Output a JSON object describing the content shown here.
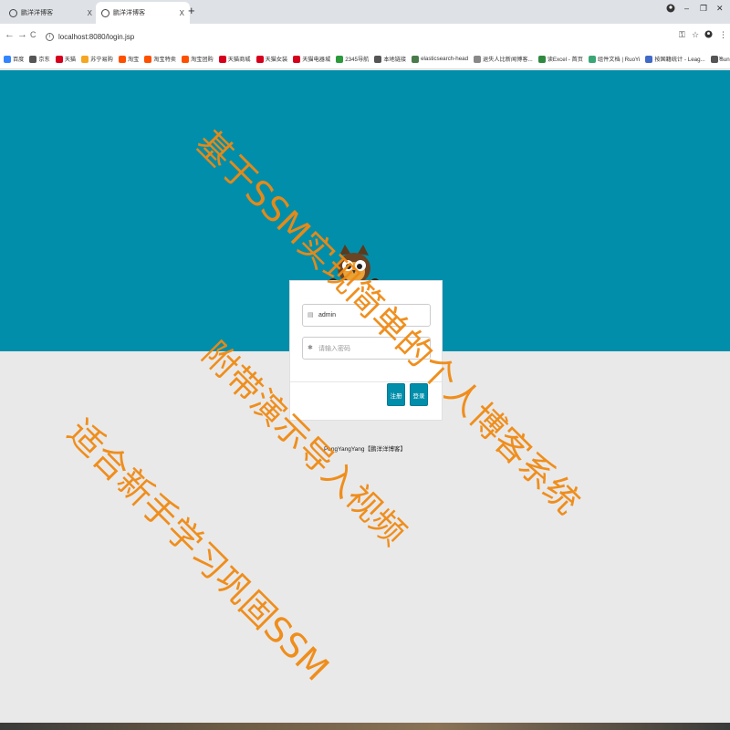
{
  "browser": {
    "tabs": [
      {
        "label": "鹏洋洋博客",
        "close": "X"
      },
      {
        "label": "鹏洋洋博客",
        "close": "X"
      }
    ],
    "new_tab": "+",
    "window_controls": {
      "minimize": "–",
      "restore": "❐",
      "close": "✕"
    },
    "nav": {
      "back": "←",
      "forward": "→",
      "reload": "C"
    },
    "url": "localhost:8080/login.jsp",
    "bookmarks": [
      {
        "label": "百度",
        "color": "#3385ff"
      },
      {
        "label": "京东",
        "color": "#555555"
      },
      {
        "label": "天猫",
        "color": "#d6001c"
      },
      {
        "label": "苏宁易购",
        "color": "#f5a623"
      },
      {
        "label": "淘宝",
        "color": "#ff5000"
      },
      {
        "label": "淘宝特卖",
        "color": "#ff5000"
      },
      {
        "label": "淘宝团购",
        "color": "#ff5000"
      },
      {
        "label": "天猫商城",
        "color": "#d6001c"
      },
      {
        "label": "天猫女装",
        "color": "#d6001c"
      },
      {
        "label": "天猫电器城",
        "color": "#d6001c"
      },
      {
        "label": "2345导航",
        "color": "#2b9a3c"
      },
      {
        "label": "本地链接",
        "color": "#555555"
      },
      {
        "label": "elasticsearch-head",
        "color": "#4a7a4a"
      },
      {
        "label": "退失人比新闻博客...",
        "color": "#888888"
      },
      {
        "label": "读Excel - 首页",
        "color": "#2f8a3f"
      },
      {
        "label": "组件文档 | RuoYi",
        "color": "#3aa675"
      },
      {
        "label": "按国籍统计 - Leag...",
        "color": "#4169c8"
      },
      {
        "label": "Sunny-Ngrok内网...",
        "color": "#555555"
      }
    ],
    "bookmarks_more": "»"
  },
  "login": {
    "username_value": "admin",
    "password_placeholder": "请输入密码",
    "register_label": "注册",
    "login_label": "登录"
  },
  "footer": {
    "text": "PengYangYang【鹏洋洋博客】"
  },
  "watermark": {
    "line1": "基于SSM实现简单的个人博客系统",
    "line2": "附带演示导入视频",
    "line3": "适合新手学习巩固SSM"
  },
  "colors": {
    "header_bg": "#008eab",
    "page_bg": "#e9e9ea",
    "button_bg": "#008eab",
    "watermark": "#f08a12"
  }
}
